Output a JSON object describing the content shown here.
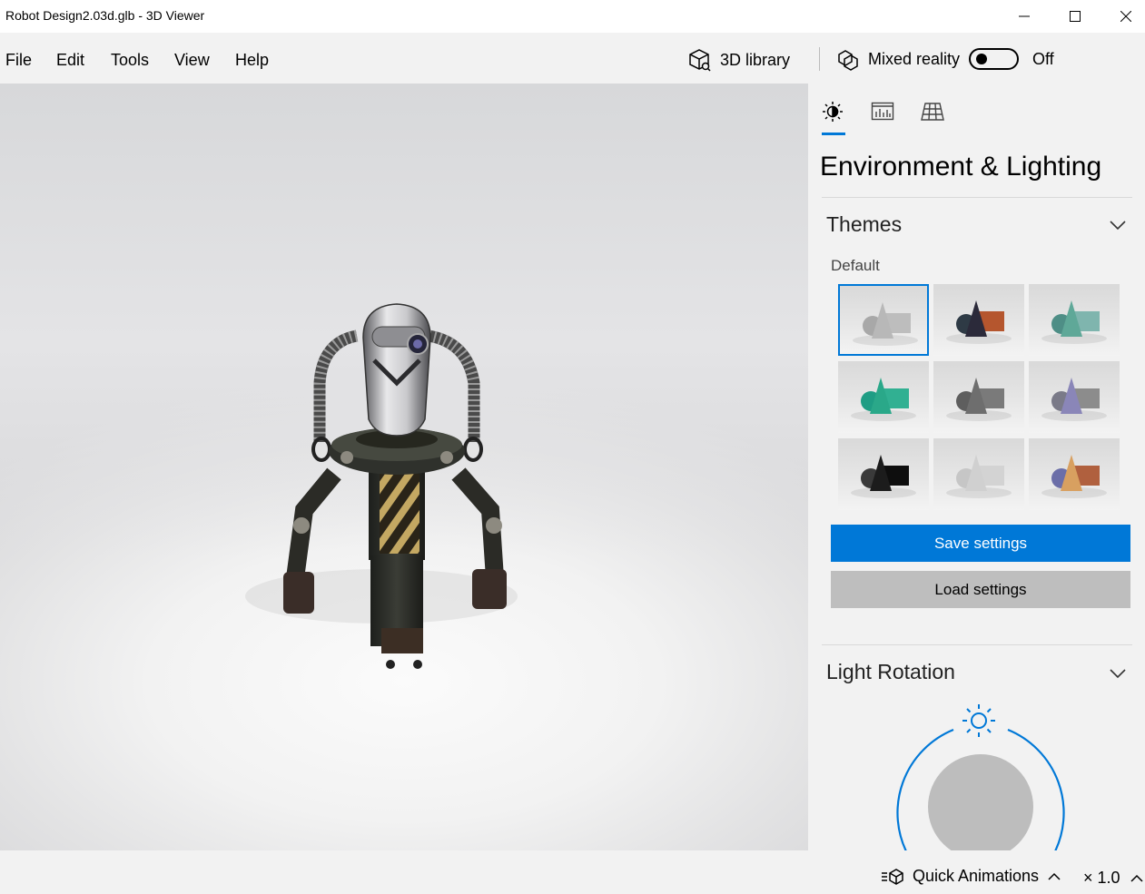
{
  "window": {
    "title": "Robot Design2.03d.glb - 3D Viewer"
  },
  "menu": {
    "items": [
      "File",
      "Edit",
      "Tools",
      "View",
      "Help"
    ]
  },
  "toolbar": {
    "library_label": "3D library",
    "mixed_reality_label": "Mixed reality",
    "mixed_reality_state": "Off"
  },
  "panel": {
    "title": "Environment & Lighting",
    "tabs": [
      "lighting-icon",
      "stats-icon",
      "grid-icon"
    ],
    "themes": {
      "title": "Themes",
      "selected_label": "Default",
      "selected_index": 0,
      "tiles": [
        {
          "cone": "#b8b8b8",
          "sphere": "#a8a8a8",
          "box": "#bdbdbd"
        },
        {
          "cone": "#2b2a3a",
          "sphere": "#2e3a45",
          "box": "#b5562e"
        },
        {
          "cone": "#5fa898",
          "sphere": "#4e8e86",
          "box": "#7fb5ae"
        },
        {
          "cone": "#2aa889",
          "sphere": "#1f9d84",
          "box": "#31b092"
        },
        {
          "cone": "#6e6e6e",
          "sphere": "#5e5e5e",
          "box": "#7a7a7a"
        },
        {
          "cone": "#8a86b8",
          "sphere": "#7a7a88",
          "box": "#8c8c8c"
        },
        {
          "cone": "#1c1c1c",
          "sphere": "#3a3a3a",
          "box": "#0e0e0e"
        },
        {
          "cone": "#d0d0d0",
          "sphere": "#c6c6c6",
          "box": "#d3d3d3"
        },
        {
          "cone": "#d8a060",
          "sphere": "#6b6ea8",
          "box": "#b0603e"
        }
      ]
    },
    "save_label": "Save settings",
    "load_label": "Load settings",
    "light_rotation": {
      "title": "Light Rotation"
    }
  },
  "status": {
    "animations_label": "Quick Animations",
    "speed_label": "× 1.0"
  },
  "colors": {
    "accent": "#0078d7",
    "button_gray": "#bebebe",
    "background": "#f2f2f2"
  }
}
